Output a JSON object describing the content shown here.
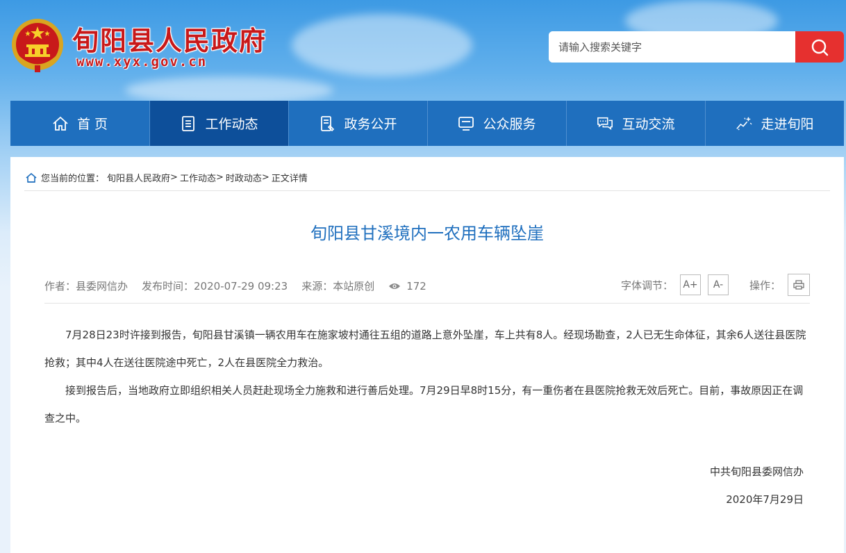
{
  "header": {
    "site_title": "旬阳县人民政府",
    "site_url": "www.xyx.gov.cn",
    "search_placeholder": "请输入搜索关键字"
  },
  "nav": [
    {
      "label": "首 页",
      "icon": "home-icon"
    },
    {
      "label": "工作动态",
      "icon": "document-list-icon",
      "active": true
    },
    {
      "label": "政务公开",
      "icon": "document-edit-icon"
    },
    {
      "label": "公众服务",
      "icon": "monitor-icon"
    },
    {
      "label": "互动交流",
      "icon": "chat-icon"
    },
    {
      "label": "走进旬阳",
      "icon": "sparkle-icon"
    }
  ],
  "breadcrumb": {
    "prefix": "您当前的位置：",
    "items": [
      "旬阳县人民政府",
      "工作动态",
      "时政动态",
      "正文详情"
    ],
    "separator": ">"
  },
  "article": {
    "title": "旬阳县甘溪境内一农用车辆坠崖",
    "author": "作者：县委网信办",
    "published": "发布时间：2020-07-29 09:23",
    "source": "来源：本站原创",
    "views": "172",
    "paragraphs": [
      "7月28日23时许接到报告，旬阳县甘溪镇一辆农用车在施家坡村通往五组的道路上意外坠崖，车上共有8人。经现场勘查，2人已无生命体征，其余6人送往县医院抢救；其中4人在送往医院途中死亡，2人在县医院全力救治。",
      "接到报告后，当地政府立即组织相关人员赶赴现场全力施救和进行善后处理。7月29日早8时15分，有一重伤者在县医院抢救无效后死亡。目前，事故原因正在调查之中。"
    ],
    "signature": "中共旬阳县委网信办",
    "date": "2020年7月29日"
  },
  "tools": {
    "font_label": "字体调节：",
    "font_increase": "A+",
    "font_decrease": "A-",
    "action_label": "操作："
  },
  "colors": {
    "brand_red": "#c8191a",
    "nav_blue": "#1f6fbe",
    "nav_active": "#0d4f9a",
    "search_red": "#e6302f",
    "title_blue": "#1f6fbe"
  }
}
